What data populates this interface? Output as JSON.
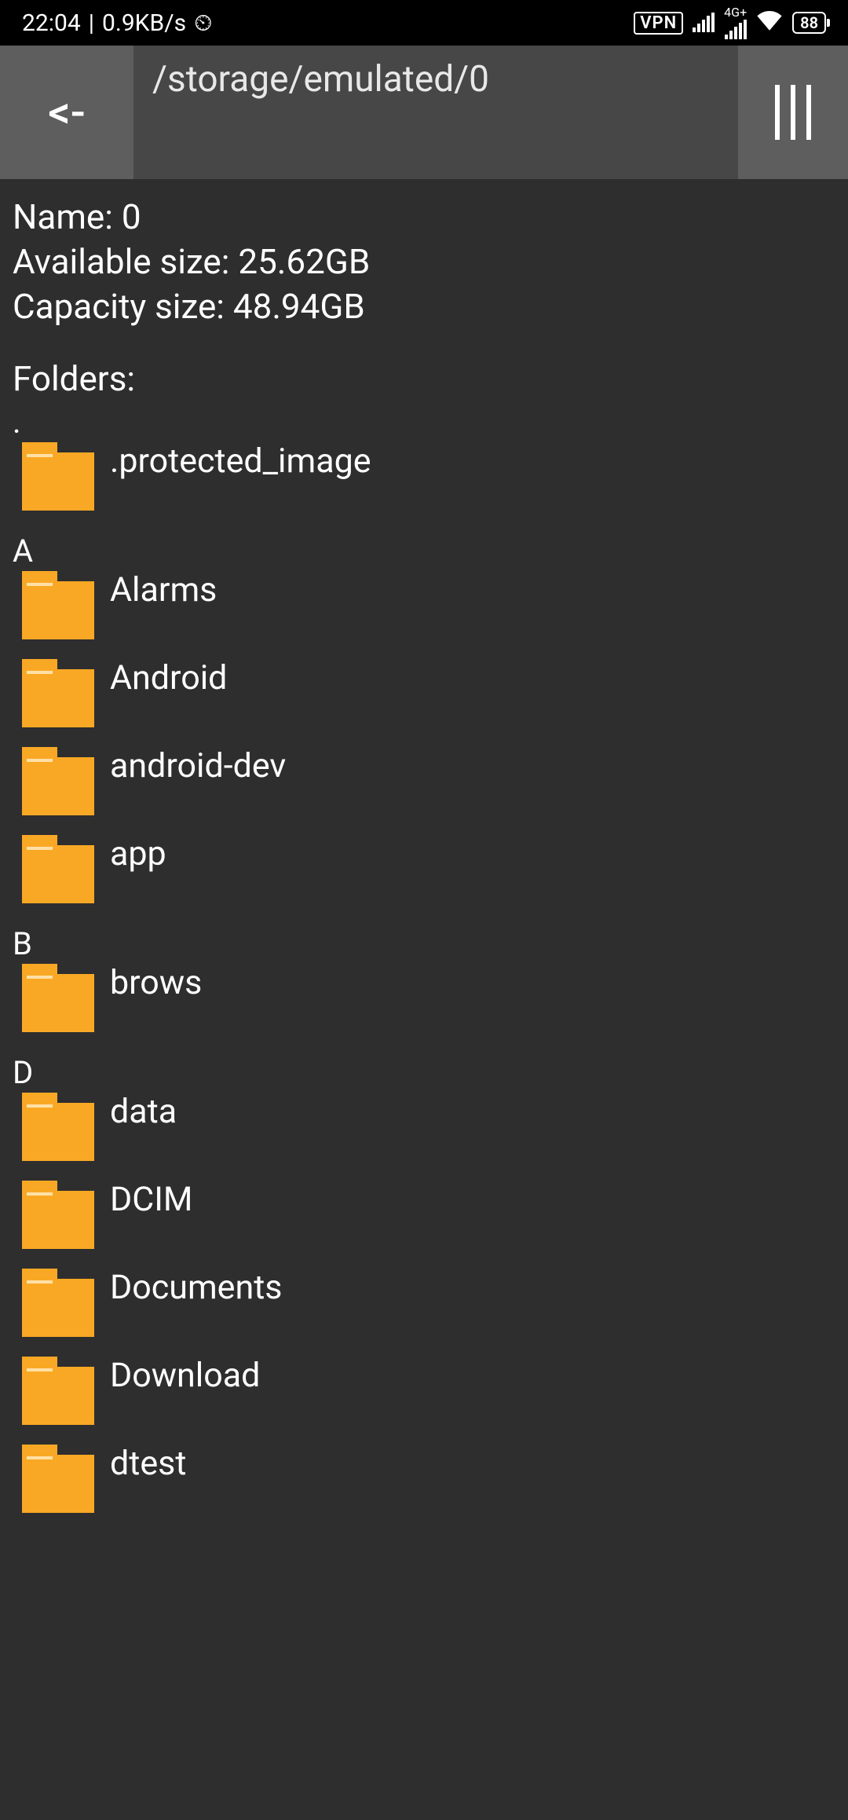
{
  "statusbar": {
    "time": "22:04",
    "separator": "|",
    "netspeed": "0.9KB/s",
    "vpn": "VPN",
    "network_type": "4G+",
    "battery": "88"
  },
  "toolbar": {
    "back": "<-",
    "path": "/storage/emulated/0"
  },
  "info": {
    "name_label": "Name:",
    "name_value": "0",
    "avail_label": "Available size:",
    "avail_value": "25.62GB",
    "cap_label": "Capacity size:",
    "cap_value": "48.94GB"
  },
  "folders_header": "Folders:",
  "sections": [
    {
      "letter": ".",
      "items": [
        {
          "name": ".protected_image"
        }
      ]
    },
    {
      "letter": "A",
      "items": [
        {
          "name": "Alarms"
        },
        {
          "name": "Android"
        },
        {
          "name": "android-dev"
        },
        {
          "name": "app"
        }
      ]
    },
    {
      "letter": "B",
      "items": [
        {
          "name": "brows"
        }
      ]
    },
    {
      "letter": "D",
      "items": [
        {
          "name": "data"
        },
        {
          "name": "DCIM"
        },
        {
          "name": "Documents"
        },
        {
          "name": "Download"
        },
        {
          "name": "dtest"
        }
      ]
    }
  ]
}
